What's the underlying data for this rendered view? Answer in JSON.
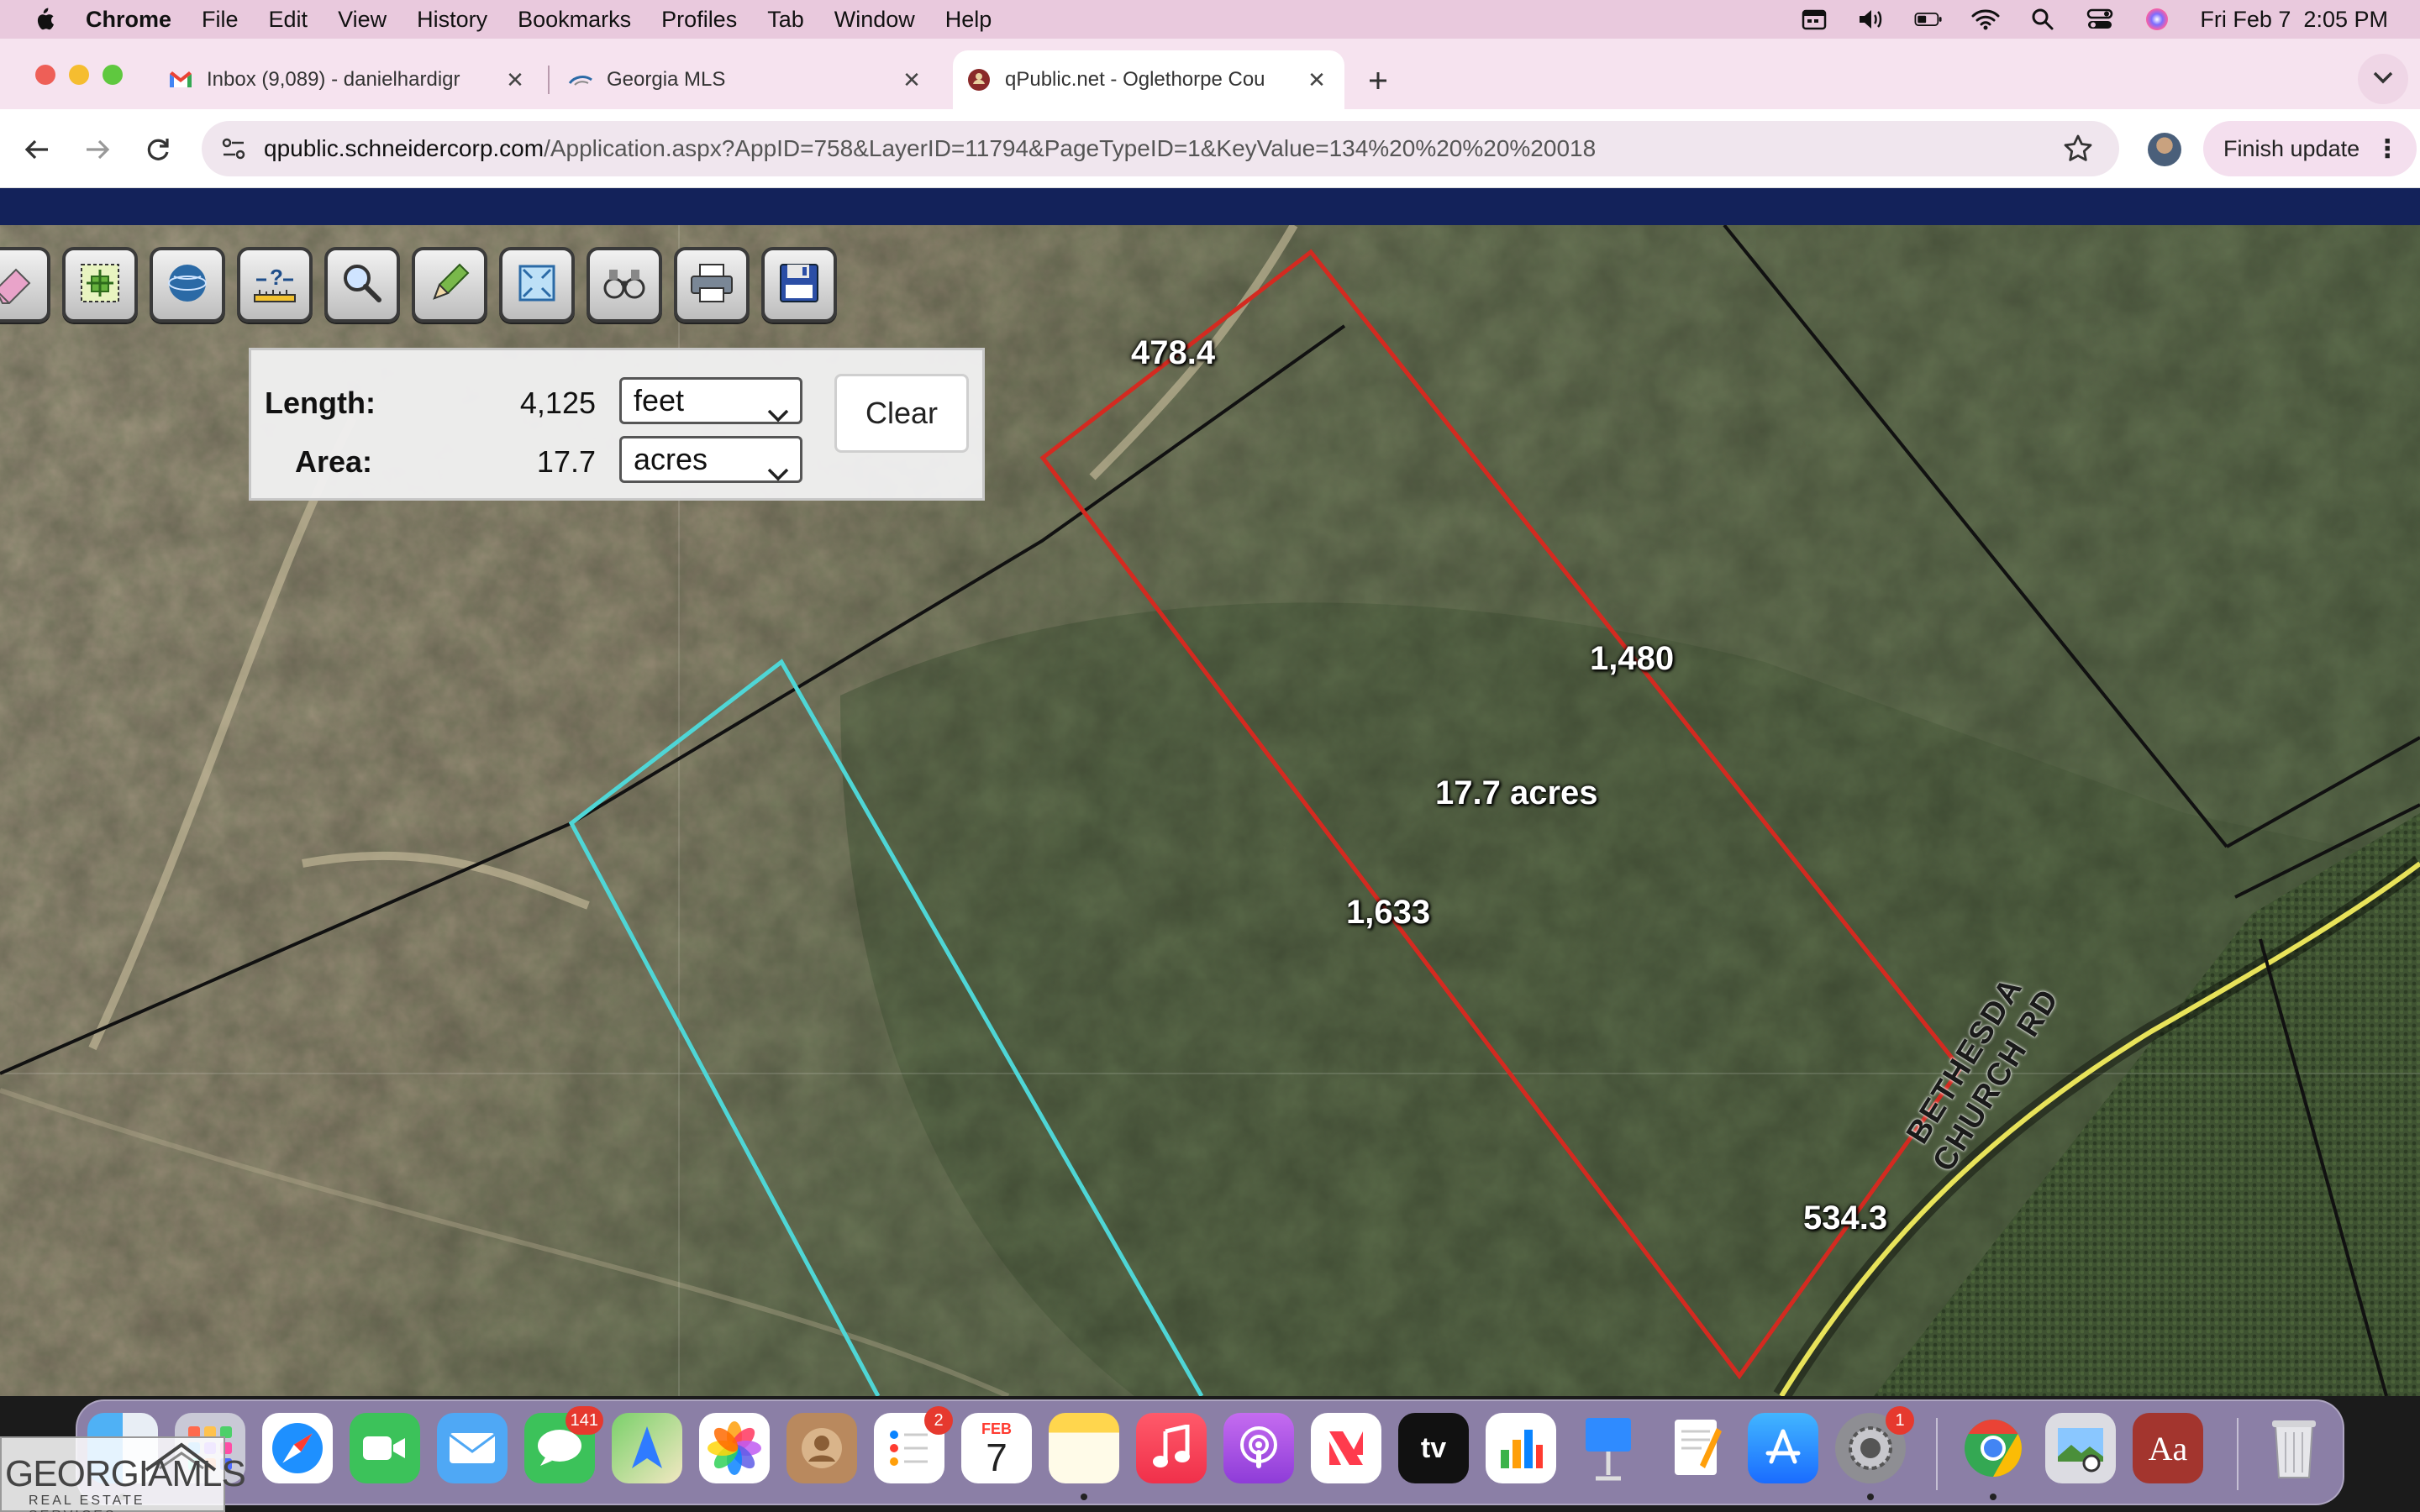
{
  "menubar": {
    "app": "Chrome",
    "items": [
      "File",
      "Edit",
      "View",
      "History",
      "Bookmarks",
      "Profiles",
      "Tab",
      "Window",
      "Help"
    ],
    "clock": "Fri Feb 7  2:05 PM",
    "status_icons": [
      "calendar-icon",
      "volume-icon",
      "battery-icon",
      "wifi-icon",
      "spotlight-icon",
      "control-center-icon",
      "siri-icon"
    ]
  },
  "tabs": [
    {
      "title": "Inbox (9,089) - danielhardigr",
      "icon": "gmail-icon"
    },
    {
      "title": "Georgia MLS",
      "icon": "georgia-mls-icon"
    },
    {
      "title": "qPublic.net - Oglethorpe Cou",
      "icon": "qpublic-icon"
    }
  ],
  "address": {
    "host": "qpublic.schneidercorp.com",
    "path": "/Application.aspx?AppID=758&LayerID=11794&PageTypeID=1&KeyValue=134%20%20%20%20018"
  },
  "finish_update": "Finish update",
  "map_tools": [
    "eraser-icon",
    "select-parcel-icon",
    "globe-icon",
    "identify-icon",
    "zoom-search-icon",
    "pencil-icon",
    "full-extent-icon",
    "binoculars-icon",
    "print-icon",
    "save-icon"
  ],
  "measure": {
    "length_label": "Length:",
    "length_value": "4,125",
    "length_unit": "feet",
    "area_label": "Area:",
    "area_value": "17.7",
    "area_unit": "acres",
    "clear": "Clear"
  },
  "parcel_labels": {
    "top": "478.4",
    "right": "1,480",
    "center": "17.7 acres",
    "left": "1,633",
    "bottom": "534.3"
  },
  "road_label_line1": "BETHESDA",
  "road_label_line2": "CHURCH RD",
  "colors": {
    "measure_outline": "#d42a20",
    "parcel_outline": "#4fd6d6",
    "header_band": "#13225a",
    "road": "#e8e35a"
  },
  "dock": {
    "apps": [
      "finder-icon",
      "launchpad-icon",
      "safari-icon",
      "facetime-icon",
      "mail-icon",
      "messages-icon",
      "maps-icon",
      "photos-icon",
      "contacts-icon",
      "reminders-icon",
      "calendar-icon",
      "notes-icon",
      "music-icon",
      "podcasts-icon",
      "news-icon",
      "appletv-icon",
      "numbers-icon",
      "keynote-icon",
      "pages-icon",
      "appstore-icon",
      "settings-icon",
      "chrome-icon",
      "preview-icon",
      "dictionary-icon",
      "trash-icon"
    ],
    "messages_badge": "141",
    "reminders_badge": "2",
    "settings_badge": "1",
    "calendar_month": "FEB",
    "calendar_day": "7",
    "appletv_label": "tv",
    "dictionary_label": "Aa"
  },
  "watermark": {
    "main": "GEORGIAMLS",
    "sub": "REAL ESTATE SERVICES"
  }
}
